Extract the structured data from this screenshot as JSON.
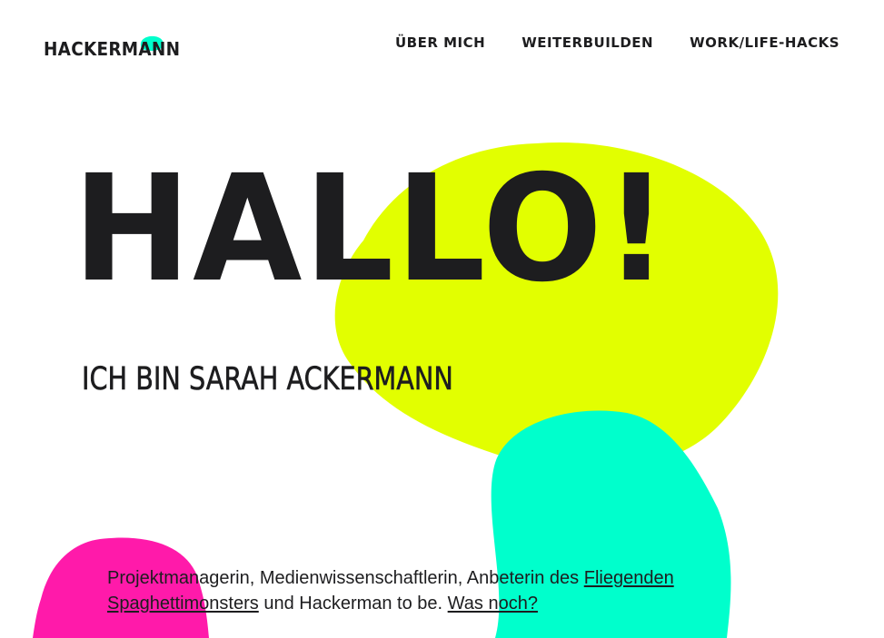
{
  "colors": {
    "lime": "#e2ff00",
    "mint": "#00ffcc",
    "pink": "#ff1aaa",
    "text": "#1d1d1f"
  },
  "header": {
    "logo_text": "Hackermann"
  },
  "nav": {
    "items": [
      {
        "label": "Über mich"
      },
      {
        "label": "Weiterbuilden"
      },
      {
        "label": "Work/Life-Hacks"
      }
    ]
  },
  "hero": {
    "title": "HALLO!",
    "subtitle": "ICH BIN SARAH ACKERMANN"
  },
  "intro": {
    "text_before": "Projektmanagerin, Medienwissenschaftlerin, Anbeterin des ",
    "link_spaghetti": "Fliegenden Spaghettimonsters",
    "text_middle": " und Hackerman to be. ",
    "link_more": "Was noch?"
  }
}
